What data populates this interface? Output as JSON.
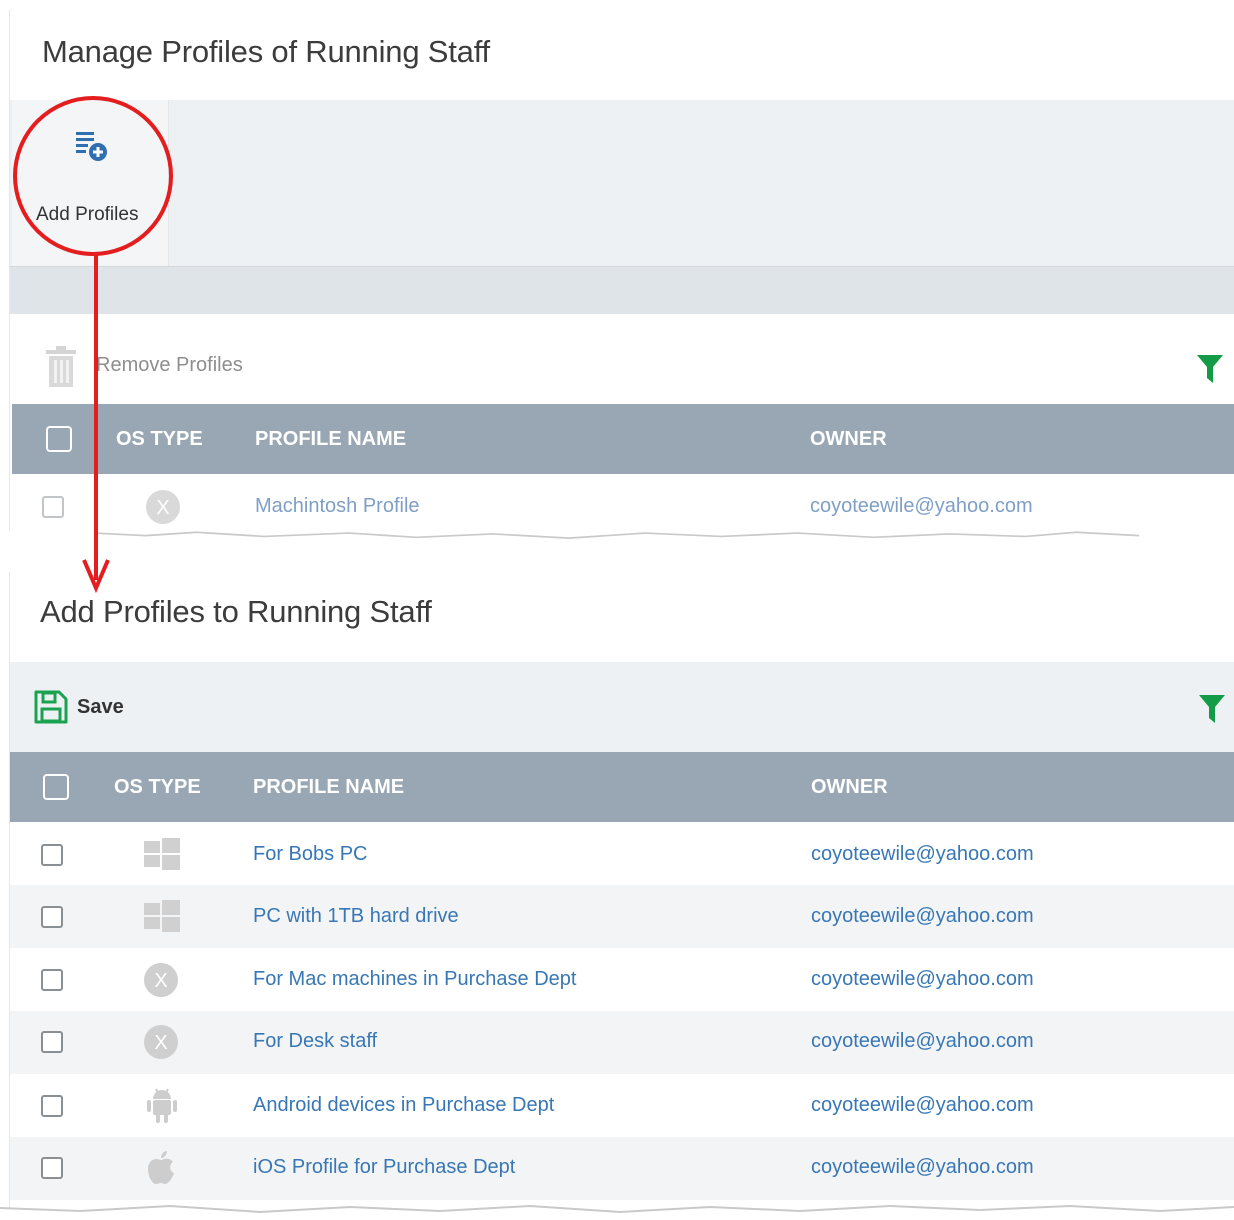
{
  "top_panel": {
    "title": "Manage Profiles of Running Staff",
    "add_profiles_label": "Add Profiles",
    "remove_profiles_label": "Remove Profiles",
    "table": {
      "headers": {
        "os_type": "OS TYPE",
        "profile_name": "PROFILE NAME",
        "owner": "OWNER"
      },
      "rows": [
        {
          "os": "mac",
          "profile_name": "Machintosh Profile",
          "owner": "coyoteewile@yahoo.com"
        }
      ]
    }
  },
  "bottom_panel": {
    "title": "Add Profiles to Running Staff",
    "save_label": "Save",
    "table": {
      "headers": {
        "os_type": "OS TYPE",
        "profile_name": "PROFILE NAME",
        "owner": "OWNER"
      },
      "rows": [
        {
          "os": "windows",
          "profile_name": "For Bobs PC",
          "owner": "coyoteewile@yahoo.com"
        },
        {
          "os": "windows",
          "profile_name": "PC with 1TB hard drive",
          "owner": "coyoteewile@yahoo.com"
        },
        {
          "os": "mac",
          "profile_name": "For Mac machines in Purchase Dept",
          "owner": "coyoteewile@yahoo.com"
        },
        {
          "os": "mac",
          "profile_name": "For Desk staff",
          "owner": "coyoteewile@yahoo.com"
        },
        {
          "os": "android",
          "profile_name": "Android devices in Purchase Dept",
          "owner": "coyoteewile@yahoo.com"
        },
        {
          "os": "ios",
          "profile_name": "iOS Profile for Purchase Dept",
          "owner": "coyoteewile@yahoo.com"
        }
      ]
    }
  },
  "icons": {
    "add_profiles": "list-add-icon",
    "remove_profiles": "trash-icon",
    "filter": "filter-icon",
    "save": "floppy-disk-icon",
    "os": [
      "windows-icon",
      "mac-os-x-icon",
      "android-icon",
      "apple-icon"
    ]
  },
  "colors": {
    "header_bg": "#98a7b3",
    "link": "#3877b5",
    "filter_green": "#149b47",
    "save_green": "#1aa251",
    "annotation_red": "#e41e1e"
  }
}
